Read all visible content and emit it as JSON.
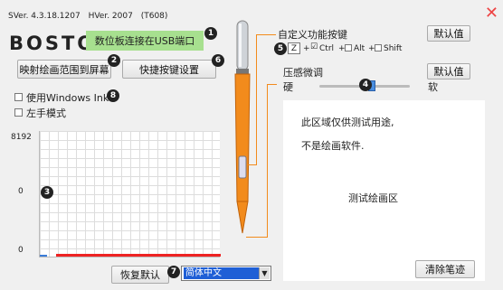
{
  "version": {
    "sver": "SVer. 4.3.18.1207",
    "hver": "HVer. 2007",
    "model": "(T608)"
  },
  "logo": "BOSTO",
  "status": {
    "text": "数位板连接在USB端口",
    "color": "#a7e08f"
  },
  "buttons": {
    "map_screen": "映射绘画范围到屏幕",
    "shortcut": "快捷按键设置",
    "default_top": "默认值",
    "default_pressure": "默认值",
    "restore": "恢复默认",
    "clear": "清除笔迹"
  },
  "checkboxes": {
    "windows_ink": "使用Windows Ink",
    "left_hand": "左手模式"
  },
  "graph": {
    "y_top": "8192",
    "y_mid": "0",
    "y_bottom": "0"
  },
  "custom_keys": {
    "title": "自定义功能按键",
    "key_value": "Z",
    "plus1": "+",
    "ctrl": "Ctrl",
    "plus2": "+",
    "alt": "Alt",
    "plus3": "+",
    "shift": "Shift"
  },
  "pressure": {
    "title": "压感微调",
    "hard": "硬",
    "soft": "软",
    "level": 0.5
  },
  "test_area": {
    "line1": "此区域仅供测试用途,",
    "line2": "不是绘画软件.",
    "title": "测试绘画区"
  },
  "language": {
    "selected": "简体中文"
  },
  "markers": [
    "1",
    "2",
    "3",
    "4",
    "5",
    "6",
    "7",
    "8"
  ]
}
